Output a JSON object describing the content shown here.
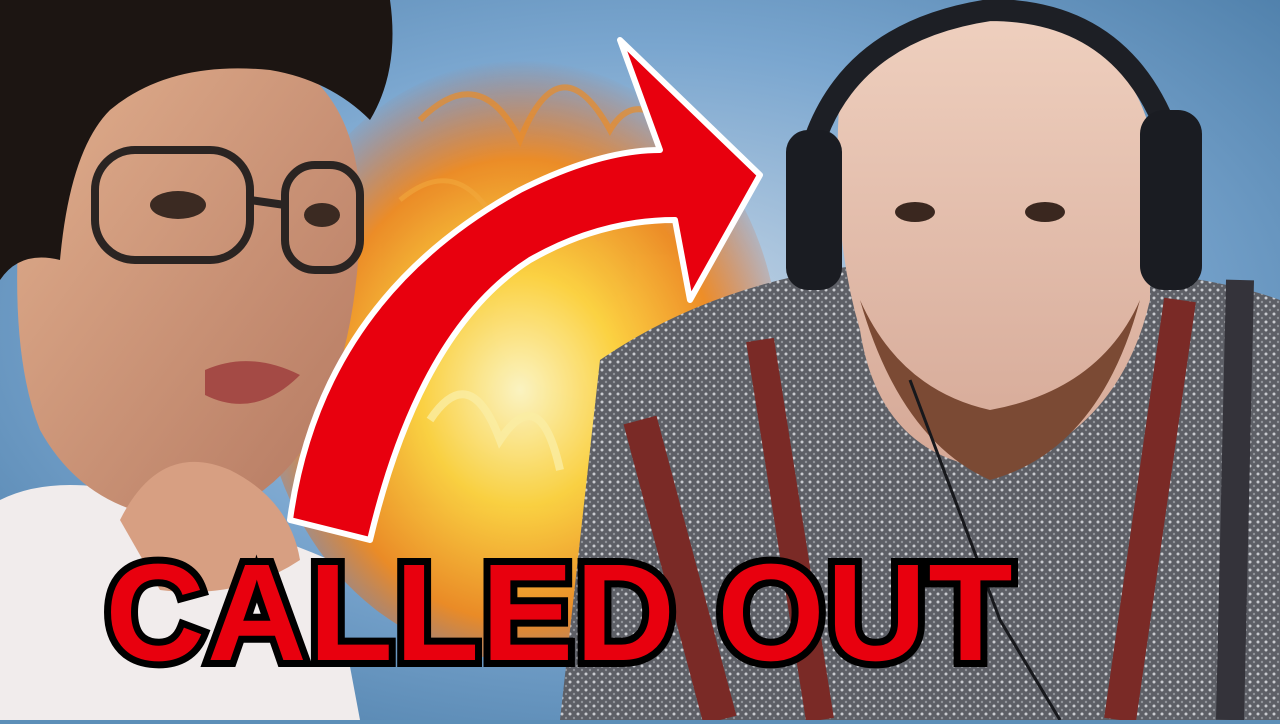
{
  "thumbnail": {
    "caption": "CALLED OUT",
    "caption_color": "#e8000e",
    "caption_outline_color": "#000000",
    "arrow_color": "#e8000e",
    "arrow_outline_color": "#ffffff",
    "background_colors": [
      "#6f9ec8",
      "#f08a1e",
      "#ffd23a"
    ]
  }
}
